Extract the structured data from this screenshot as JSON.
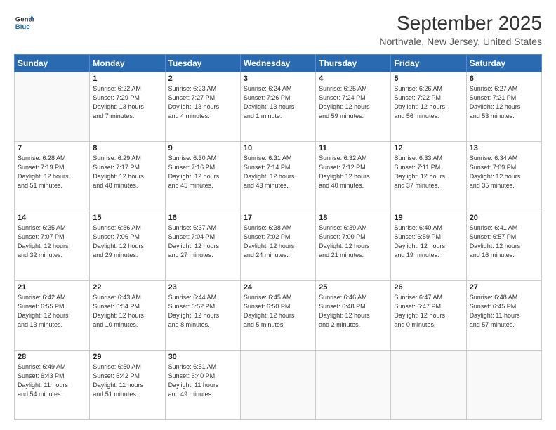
{
  "header": {
    "logo_line1": "General",
    "logo_line2": "Blue",
    "title": "September 2025",
    "subtitle": "Northvale, New Jersey, United States"
  },
  "weekdays": [
    "Sunday",
    "Monday",
    "Tuesday",
    "Wednesday",
    "Thursday",
    "Friday",
    "Saturday"
  ],
  "weeks": [
    [
      {
        "day": "",
        "info": ""
      },
      {
        "day": "1",
        "info": "Sunrise: 6:22 AM\nSunset: 7:29 PM\nDaylight: 13 hours\nand 7 minutes."
      },
      {
        "day": "2",
        "info": "Sunrise: 6:23 AM\nSunset: 7:27 PM\nDaylight: 13 hours\nand 4 minutes."
      },
      {
        "day": "3",
        "info": "Sunrise: 6:24 AM\nSunset: 7:26 PM\nDaylight: 13 hours\nand 1 minute."
      },
      {
        "day": "4",
        "info": "Sunrise: 6:25 AM\nSunset: 7:24 PM\nDaylight: 12 hours\nand 59 minutes."
      },
      {
        "day": "5",
        "info": "Sunrise: 6:26 AM\nSunset: 7:22 PM\nDaylight: 12 hours\nand 56 minutes."
      },
      {
        "day": "6",
        "info": "Sunrise: 6:27 AM\nSunset: 7:21 PM\nDaylight: 12 hours\nand 53 minutes."
      }
    ],
    [
      {
        "day": "7",
        "info": "Sunrise: 6:28 AM\nSunset: 7:19 PM\nDaylight: 12 hours\nand 51 minutes."
      },
      {
        "day": "8",
        "info": "Sunrise: 6:29 AM\nSunset: 7:17 PM\nDaylight: 12 hours\nand 48 minutes."
      },
      {
        "day": "9",
        "info": "Sunrise: 6:30 AM\nSunset: 7:16 PM\nDaylight: 12 hours\nand 45 minutes."
      },
      {
        "day": "10",
        "info": "Sunrise: 6:31 AM\nSunset: 7:14 PM\nDaylight: 12 hours\nand 43 minutes."
      },
      {
        "day": "11",
        "info": "Sunrise: 6:32 AM\nSunset: 7:12 PM\nDaylight: 12 hours\nand 40 minutes."
      },
      {
        "day": "12",
        "info": "Sunrise: 6:33 AM\nSunset: 7:11 PM\nDaylight: 12 hours\nand 37 minutes."
      },
      {
        "day": "13",
        "info": "Sunrise: 6:34 AM\nSunset: 7:09 PM\nDaylight: 12 hours\nand 35 minutes."
      }
    ],
    [
      {
        "day": "14",
        "info": "Sunrise: 6:35 AM\nSunset: 7:07 PM\nDaylight: 12 hours\nand 32 minutes."
      },
      {
        "day": "15",
        "info": "Sunrise: 6:36 AM\nSunset: 7:06 PM\nDaylight: 12 hours\nand 29 minutes."
      },
      {
        "day": "16",
        "info": "Sunrise: 6:37 AM\nSunset: 7:04 PM\nDaylight: 12 hours\nand 27 minutes."
      },
      {
        "day": "17",
        "info": "Sunrise: 6:38 AM\nSunset: 7:02 PM\nDaylight: 12 hours\nand 24 minutes."
      },
      {
        "day": "18",
        "info": "Sunrise: 6:39 AM\nSunset: 7:00 PM\nDaylight: 12 hours\nand 21 minutes."
      },
      {
        "day": "19",
        "info": "Sunrise: 6:40 AM\nSunset: 6:59 PM\nDaylight: 12 hours\nand 19 minutes."
      },
      {
        "day": "20",
        "info": "Sunrise: 6:41 AM\nSunset: 6:57 PM\nDaylight: 12 hours\nand 16 minutes."
      }
    ],
    [
      {
        "day": "21",
        "info": "Sunrise: 6:42 AM\nSunset: 6:55 PM\nDaylight: 12 hours\nand 13 minutes."
      },
      {
        "day": "22",
        "info": "Sunrise: 6:43 AM\nSunset: 6:54 PM\nDaylight: 12 hours\nand 10 minutes."
      },
      {
        "day": "23",
        "info": "Sunrise: 6:44 AM\nSunset: 6:52 PM\nDaylight: 12 hours\nand 8 minutes."
      },
      {
        "day": "24",
        "info": "Sunrise: 6:45 AM\nSunset: 6:50 PM\nDaylight: 12 hours\nand 5 minutes."
      },
      {
        "day": "25",
        "info": "Sunrise: 6:46 AM\nSunset: 6:48 PM\nDaylight: 12 hours\nand 2 minutes."
      },
      {
        "day": "26",
        "info": "Sunrise: 6:47 AM\nSunset: 6:47 PM\nDaylight: 12 hours\nand 0 minutes."
      },
      {
        "day": "27",
        "info": "Sunrise: 6:48 AM\nSunset: 6:45 PM\nDaylight: 11 hours\nand 57 minutes."
      }
    ],
    [
      {
        "day": "28",
        "info": "Sunrise: 6:49 AM\nSunset: 6:43 PM\nDaylight: 11 hours\nand 54 minutes."
      },
      {
        "day": "29",
        "info": "Sunrise: 6:50 AM\nSunset: 6:42 PM\nDaylight: 11 hours\nand 51 minutes."
      },
      {
        "day": "30",
        "info": "Sunrise: 6:51 AM\nSunset: 6:40 PM\nDaylight: 11 hours\nand 49 minutes."
      },
      {
        "day": "",
        "info": ""
      },
      {
        "day": "",
        "info": ""
      },
      {
        "day": "",
        "info": ""
      },
      {
        "day": "",
        "info": ""
      }
    ]
  ]
}
